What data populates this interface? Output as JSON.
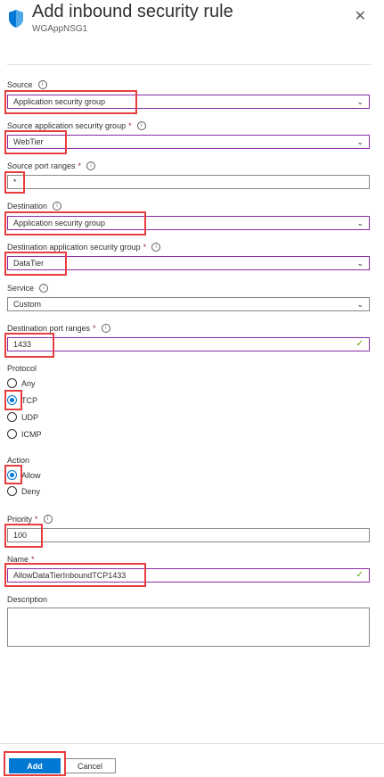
{
  "header": {
    "title": "Add inbound security rule",
    "subtitle": "WGAppNSG1",
    "close_glyph": "✕",
    "icon": "shield-icon"
  },
  "form": {
    "source": {
      "label": "Source",
      "value": "Application security group"
    },
    "source_asg": {
      "label": "Source application security group",
      "required": "*",
      "value": "WebTier"
    },
    "source_port_ranges": {
      "label": "Source port ranges",
      "required": "*",
      "value": "*"
    },
    "destination": {
      "label": "Destination",
      "value": "Application security group"
    },
    "destination_asg": {
      "label": "Destination application security group",
      "required": "*",
      "value": "DataTier"
    },
    "service": {
      "label": "Service",
      "value": "Custom"
    },
    "destination_port_ranges": {
      "label": "Destination port ranges",
      "required": "*",
      "value": "1433"
    },
    "protocol": {
      "label": "Protocol",
      "options": [
        "Any",
        "TCP",
        "UDP",
        "ICMP"
      ],
      "selected": "TCP"
    },
    "action": {
      "label": "Action",
      "options": [
        "Allow",
        "Deny"
      ],
      "selected": "Allow"
    },
    "priority": {
      "label": "Priority",
      "required": "*",
      "value": "100"
    },
    "name": {
      "label": "Name",
      "required": "*",
      "value": "AllowDataTierInboundTCP1433"
    },
    "description": {
      "label": "Description",
      "value": ""
    }
  },
  "footer": {
    "add_label": "Add",
    "cancel_label": "Cancel"
  },
  "colors": {
    "accent": "#0078d4",
    "highlight": "#e63e3e",
    "select_border": "#8a2da5",
    "valid_check": "#57a300"
  }
}
